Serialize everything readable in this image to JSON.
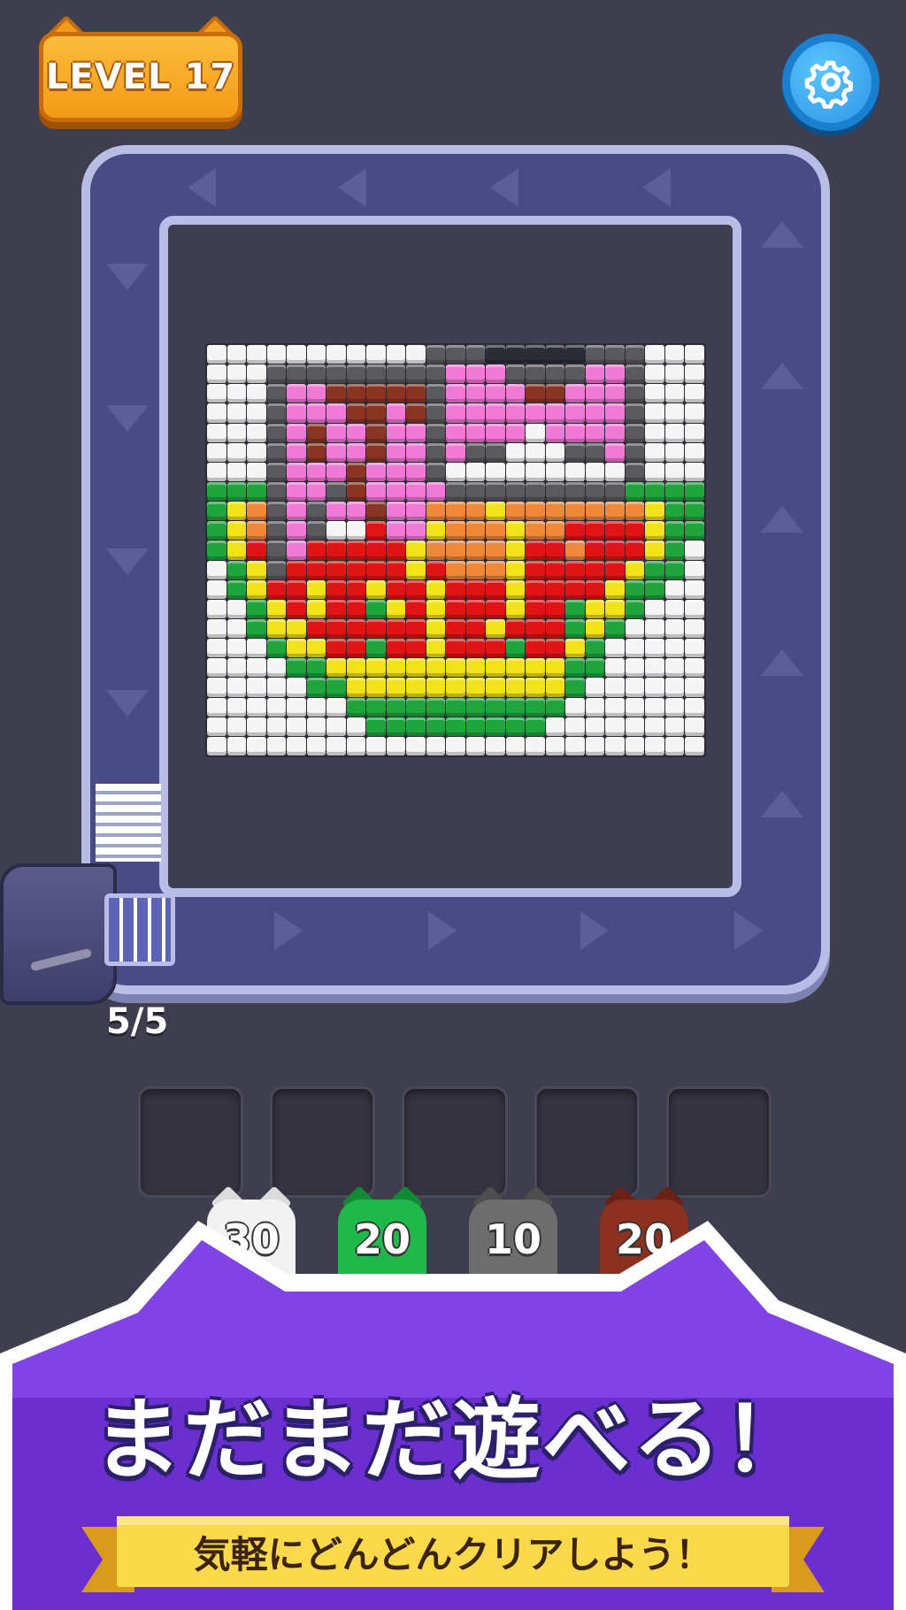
{
  "header": {
    "level_label": "LEVEL 17"
  },
  "board": {
    "counter": "5/5"
  },
  "slots_count": 5,
  "cats": [
    {
      "count": "30",
      "color": "#f2f2f2",
      "ear": "#dcdcdc"
    },
    {
      "count": "20",
      "color": "#1fb84a",
      "ear": "#128a35"
    },
    {
      "count": "10",
      "color": "#6d6d6d",
      "ear": "#4e4e4e"
    },
    {
      "count": "20",
      "color": "#8c3020",
      "ear": "#6b2216"
    }
  ],
  "promo": {
    "headline": "まだまだ遊べる！",
    "subline": "気軽にどんどんクリアしよう！"
  },
  "colors": {
    "W": "#f4f4f4",
    "K": "#5a5a5e",
    "P": "#f07ad6",
    "B": "#8a3424",
    "G": "#1fa53c",
    "Y": "#f2e21a",
    "R": "#e01414",
    "O": "#f0883a",
    "D": "#2c2c36"
  },
  "pixel_rows": [
    "WWWWWWWWWWWKKKDDDDDKKKWWW",
    "WWWKKKKKKKKKPPPKKKKPPKWWW",
    "WWWKPPBBBBBKPPPPBBPPPKWWW",
    "WWWKPPPBBPBKPPPPPPPPPKWWW",
    "WWWKPBPPBPPKPPPPWPPPPKWWW",
    "WWWKPBPPBPPKPKKWWWKKPKWWW",
    "WWWKPPPBPPPKWWWWWWWWWKWWW",
    "GGGKPPKBPPPPKKKKKKKKKGGGG",
    "GYOKPKPPBPPOOOYOOOOOOOYGG",
    "GYOKPKWWRPPYOOOYOORRRRYGG",
    "GYRKPRRRRRYOOOOYRRORRRYGW",
    "WGYKRRRRRRYROOOYRRRRRYGGW",
    "WGYRRYRRYRRYRRRYRRRRYGGWW",
    "WWGYRYRRGYRYRRRYRRGYYGWWW",
    "WWGYYRRRRRRYRRYRRRGYGWWWW",
    "WWWGYYRRGRRYRRRGRRYGWWWWW",
    "WWWWGGYYYYYYYYYYYYGGWWWWW",
    "WWWWWGGYYYYYYYYYYYGWWWWWW",
    "WWWWWWWGGGGGGGGGGGWWWWWWW",
    "WWWWWWWWGGGGGGGGGWWWWWWWW",
    "WWWWWWWWWWWWWWWWWWWWWWWWW"
  ]
}
